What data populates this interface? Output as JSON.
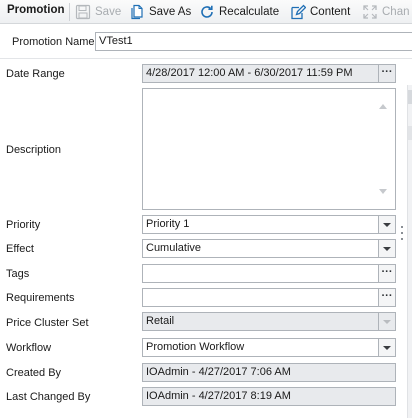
{
  "toolbar": {
    "title": "Promotion",
    "save_label": "Save",
    "save_as_label": "Save As",
    "recalculate_label": "Recalculate",
    "content_label": "Content",
    "change_label": "Chan"
  },
  "form": {
    "name_label": "Promotion Name",
    "name_value": "VTest1",
    "date_range_label": "Date Range",
    "date_range_value": "4/28/2017 12:00 AM - 6/30/2017 11:59 PM",
    "description_label": "Description",
    "description_value": "",
    "priority_label": "Priority",
    "priority_value": "Priority 1",
    "effect_label": "Effect",
    "effect_value": "Cumulative",
    "tags_label": "Tags",
    "tags_value": "",
    "requirements_label": "Requirements",
    "requirements_value": "",
    "price_cluster_label": "Price Cluster Set",
    "price_cluster_value": "Retail",
    "workflow_label": "Workflow",
    "workflow_value": "Promotion Workflow",
    "created_by_label": "Created By",
    "created_by_value": "IOAdmin - 4/27/2017 7:06 AM",
    "last_changed_label": "Last Changed By",
    "last_changed_value": "IOAdmin - 4/27/2017 8:19 AM"
  },
  "icons": {
    "save": "floppy-disk-icon",
    "save_as": "document-copy-icon",
    "recalculate": "refresh-icon",
    "content": "edit-document-icon",
    "change": "expand-arrows-icon",
    "ellipsis": "ellipsis-icon",
    "dropdown": "chevron-down-icon"
  },
  "colors": {
    "accent": "#1f6fb5",
    "readonly_bg": "#e8eaed",
    "border": "#aeb3b9",
    "disabled_text": "#a8acb0"
  }
}
